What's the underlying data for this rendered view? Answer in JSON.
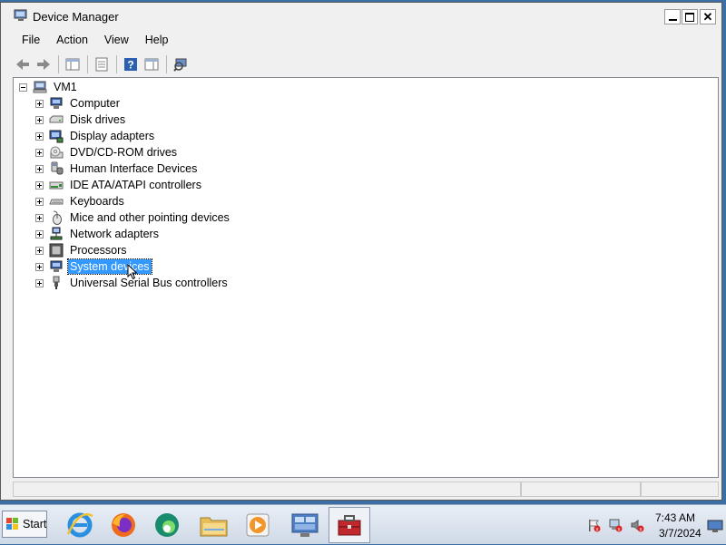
{
  "window": {
    "title": "Device Manager",
    "icon": "device-manager-icon"
  },
  "menu": [
    "File",
    "Action",
    "View",
    "Help"
  ],
  "toolbar": {
    "buttons": [
      "back-arrow-icon",
      "forward-arrow-icon",
      "show-hide-tree-icon",
      "properties-icon",
      "help-icon",
      "action-pane-icon",
      "scan-hardware-icon"
    ]
  },
  "tree": {
    "root": "VM1",
    "items": [
      {
        "label": "Computer",
        "icon": "computer-icon"
      },
      {
        "label": "Disk drives",
        "icon": "disk-drive-icon"
      },
      {
        "label": "Display adapters",
        "icon": "display-adapter-icon"
      },
      {
        "label": "DVD/CD-ROM drives",
        "icon": "dvd-drive-icon"
      },
      {
        "label": "Human Interface Devices",
        "icon": "hid-icon"
      },
      {
        "label": "IDE ATA/ATAPI controllers",
        "icon": "ide-controller-icon"
      },
      {
        "label": "Keyboards",
        "icon": "keyboard-icon"
      },
      {
        "label": "Mice and other pointing devices",
        "icon": "mouse-icon"
      },
      {
        "label": "Network adapters",
        "icon": "network-adapter-icon"
      },
      {
        "label": "Processors",
        "icon": "processor-icon"
      },
      {
        "label": "System devices",
        "icon": "system-devices-icon"
      },
      {
        "label": "Universal Serial Bus controllers",
        "icon": "usb-icon"
      }
    ],
    "selected": "System devices"
  },
  "taskbar": {
    "start_label": "Start",
    "apps": [
      "internet-explorer-icon",
      "firefox-icon",
      "edge-icon",
      "file-explorer-icon",
      "media-player-icon",
      "server-manager-icon",
      "toolbox-icon"
    ],
    "tray": [
      "flag-alert-icon",
      "network-alert-icon",
      "volume-muted-icon"
    ],
    "time": "7:43 AM",
    "date": "3/7/2024"
  }
}
